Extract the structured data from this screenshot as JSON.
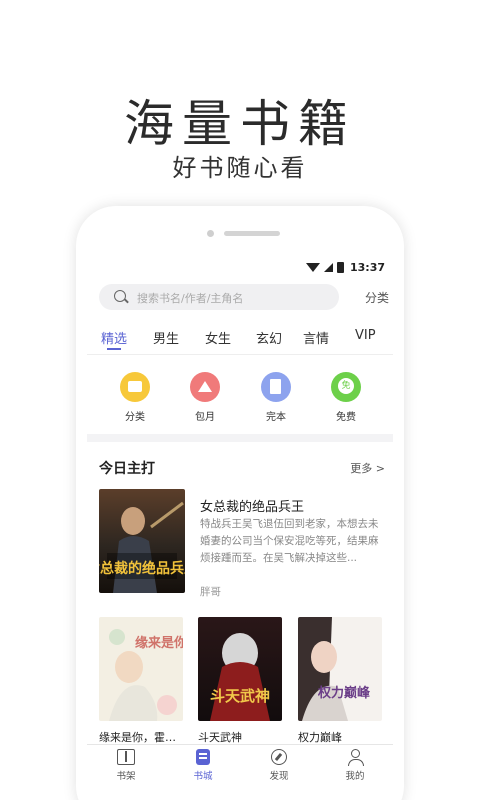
{
  "hero": {
    "title": "海量书籍",
    "subtitle": "好书随心看"
  },
  "status": {
    "time": "13:37"
  },
  "search": {
    "placeholder": "搜索书名/作者/主角名",
    "category_link": "分类"
  },
  "tabs": [
    {
      "label": "精选",
      "active": true
    },
    {
      "label": "男生"
    },
    {
      "label": "女生"
    },
    {
      "label": "玄幻"
    },
    {
      "label": "言情"
    },
    {
      "label": "VIP"
    }
  ],
  "quick": [
    {
      "label": "分类",
      "icon": "category-icon",
      "color": "#f7c83a"
    },
    {
      "label": "包月",
      "icon": "crown-icon",
      "color": "#f07a7a"
    },
    {
      "label": "完本",
      "icon": "book-icon",
      "color": "#8da3ee"
    },
    {
      "label": "免费",
      "icon": "free-icon",
      "color": "#6dd04a"
    }
  ],
  "section": {
    "title": "今日主打",
    "more": "更多 >"
  },
  "featured": {
    "title": "女总裁的绝品兵王",
    "description": "特战兵王吴飞退伍回到老家，本想去未婚妻的公司当个保安混吃等死，结果麻烦接踵而至。在吴飞解决掉这些...",
    "author": "胖哥",
    "cover_text": "女总裁的绝品兵王"
  },
  "books": [
    {
      "title": "缘来是你，霍少...",
      "cover_text": "缘来是你"
    },
    {
      "title": "斗天武神",
      "cover_text": "斗天武神"
    },
    {
      "title": "权力巅峰",
      "cover_text": "权力巅峰"
    }
  ],
  "nav": [
    {
      "label": "书架",
      "icon": "bookshelf-icon"
    },
    {
      "label": "书城",
      "icon": "bookstore-icon",
      "active": true
    },
    {
      "label": "发现",
      "icon": "compass-icon"
    },
    {
      "label": "我的",
      "icon": "profile-icon"
    }
  ],
  "colors": {
    "accent": "#5a63d3"
  }
}
